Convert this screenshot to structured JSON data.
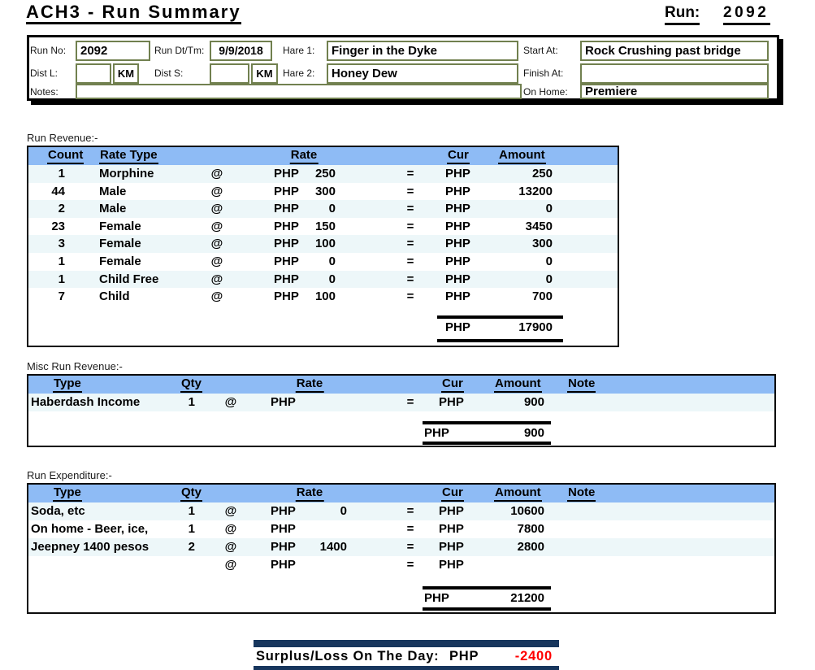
{
  "title": "ACH3 - Run Summary",
  "run_header": {
    "label": "Run:",
    "value": "2092"
  },
  "form": {
    "run_no": {
      "label": "Run No:",
      "value": "2092"
    },
    "run_dttm": {
      "label": "Run Dt/Tm:",
      "value": "9/9/2018"
    },
    "hare1": {
      "label": "Hare 1:",
      "value": "Finger in the Dyke"
    },
    "start_at": {
      "label": "Start At:",
      "value": "Rock Crushing past bridge"
    },
    "dist_l": {
      "label": "Dist L:",
      "value": "",
      "unit": "KM"
    },
    "dist_s": {
      "label": "Dist S:",
      "value": "",
      "unit": "KM"
    },
    "hare2": {
      "label": "Hare 2:",
      "value": "Honey Dew"
    },
    "finish_at": {
      "label": "Finish At:",
      "value": ""
    },
    "notes": {
      "label": "Notes:",
      "value": ""
    },
    "on_home": {
      "label": "On Home:",
      "value": "Premiere"
    }
  },
  "symbols": {
    "at": "@",
    "equals": "=",
    "currency": "PHP"
  },
  "revenue": {
    "section_label": "Run Revenue:-",
    "headers": {
      "count": "Count",
      "rate_type": "Rate Type",
      "rate": "Rate",
      "cur": "Cur",
      "amount": "Amount"
    },
    "rows": [
      {
        "count": "1",
        "rate_type": "Morphine",
        "rate": "250",
        "amount": "250"
      },
      {
        "count": "44",
        "rate_type": "Male",
        "rate": "300",
        "amount": "13200"
      },
      {
        "count": "2",
        "rate_type": "Male",
        "rate": "0",
        "amount": "0"
      },
      {
        "count": "23",
        "rate_type": "Female",
        "rate": "150",
        "amount": "3450"
      },
      {
        "count": "3",
        "rate_type": "Female",
        "rate": "100",
        "amount": "300"
      },
      {
        "count": "1",
        "rate_type": "Female",
        "rate": "0",
        "amount": "0"
      },
      {
        "count": "1",
        "rate_type": "Child Free",
        "rate": "0",
        "amount": "0"
      },
      {
        "count": "7",
        "rate_type": "Child",
        "rate": "100",
        "amount": "700"
      }
    ],
    "total": {
      "cur": "PHP",
      "amount": "17900"
    }
  },
  "misc_revenue": {
    "section_label": "Misc Run Revenue:-",
    "headers": {
      "type": "Type",
      "qty": "Qty",
      "rate": "Rate",
      "cur": "Cur",
      "amount": "Amount",
      "note": "Note"
    },
    "rows": [
      {
        "type": "Haberdash Income",
        "qty": "1",
        "rate": "",
        "amount": "900",
        "note": ""
      }
    ],
    "total": {
      "cur": "PHP",
      "amount": "900"
    }
  },
  "expenditure": {
    "section_label": "Run Expenditure:-",
    "headers": {
      "type": "Type",
      "qty": "Qty",
      "rate": "Rate",
      "cur": "Cur",
      "amount": "Amount",
      "note": "Note"
    },
    "rows": [
      {
        "type": "Soda, etc",
        "qty": "1",
        "rate": "0",
        "amount": "10600",
        "note": ""
      },
      {
        "type": "On home - Beer, ice,",
        "qty": "1",
        "rate": "",
        "amount": "7800",
        "note": ""
      },
      {
        "type": "Jeepney 1400 pesos",
        "qty": "2",
        "rate": "1400",
        "amount": "2800",
        "note": ""
      },
      {
        "type": "",
        "qty": "",
        "rate": "",
        "amount": "",
        "note": ""
      }
    ],
    "total": {
      "cur": "PHP",
      "amount": "21200"
    }
  },
  "summary": {
    "label": "Surplus/Loss On The Day:",
    "cur": "PHP",
    "amount": "-2400"
  },
  "colors": {
    "table_header_bg": "#8ebbf5",
    "row_alt_bg": "#edf7f9",
    "bar_navy": "#17365d",
    "negative_red": "#ff0000",
    "input_border": "#7d8a5f"
  }
}
